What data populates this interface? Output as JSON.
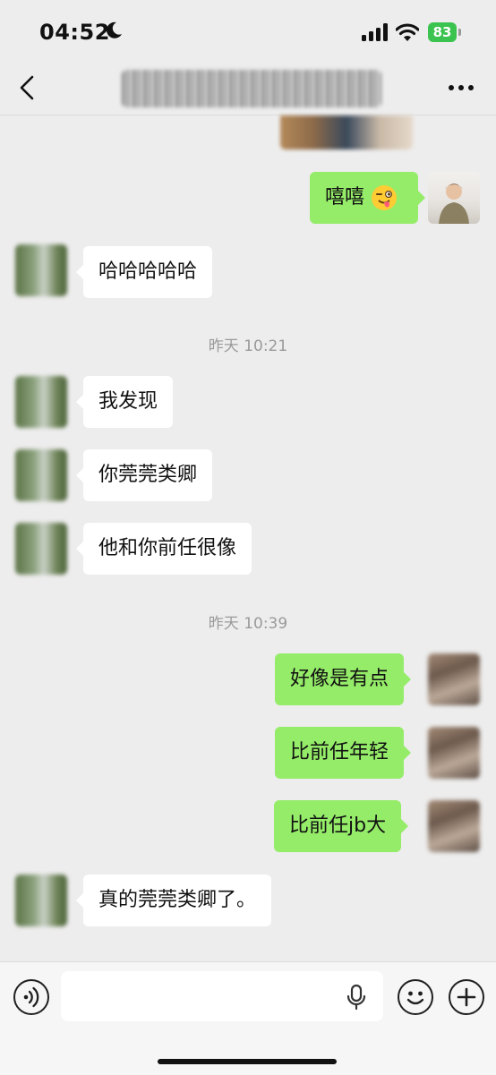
{
  "status": {
    "time": "04:52",
    "battery": "83"
  },
  "icons": {
    "back": "chevron-left-icon",
    "more": "more-horizontal-icon",
    "voice": "voice-mode-icon",
    "mic": "microphone-icon",
    "emoji": "emoji-icon",
    "plus": "add-icon",
    "moon": "moon-icon"
  },
  "colors": {
    "background": "#ededed",
    "my_bubble": "#95ec69",
    "their_bubble": "#ffffff",
    "timestamp": "#9a9a9a"
  },
  "chat": {
    "msg_xixi": "嘻嘻",
    "msg_hahaha": "哈哈哈哈哈",
    "timestamp_1": "昨天 10:21",
    "msg_faxian": "我发现",
    "msg_guanguan": "你莞莞类卿",
    "msg_qianren": "他和你前任很像",
    "timestamp_2": "昨天 10:39",
    "msg_youdian": "好像是有点",
    "msg_nianqing": "比前任年轻",
    "msg_jbda": "比前任jb大",
    "msg_zhende": "真的莞莞类卿了。"
  }
}
